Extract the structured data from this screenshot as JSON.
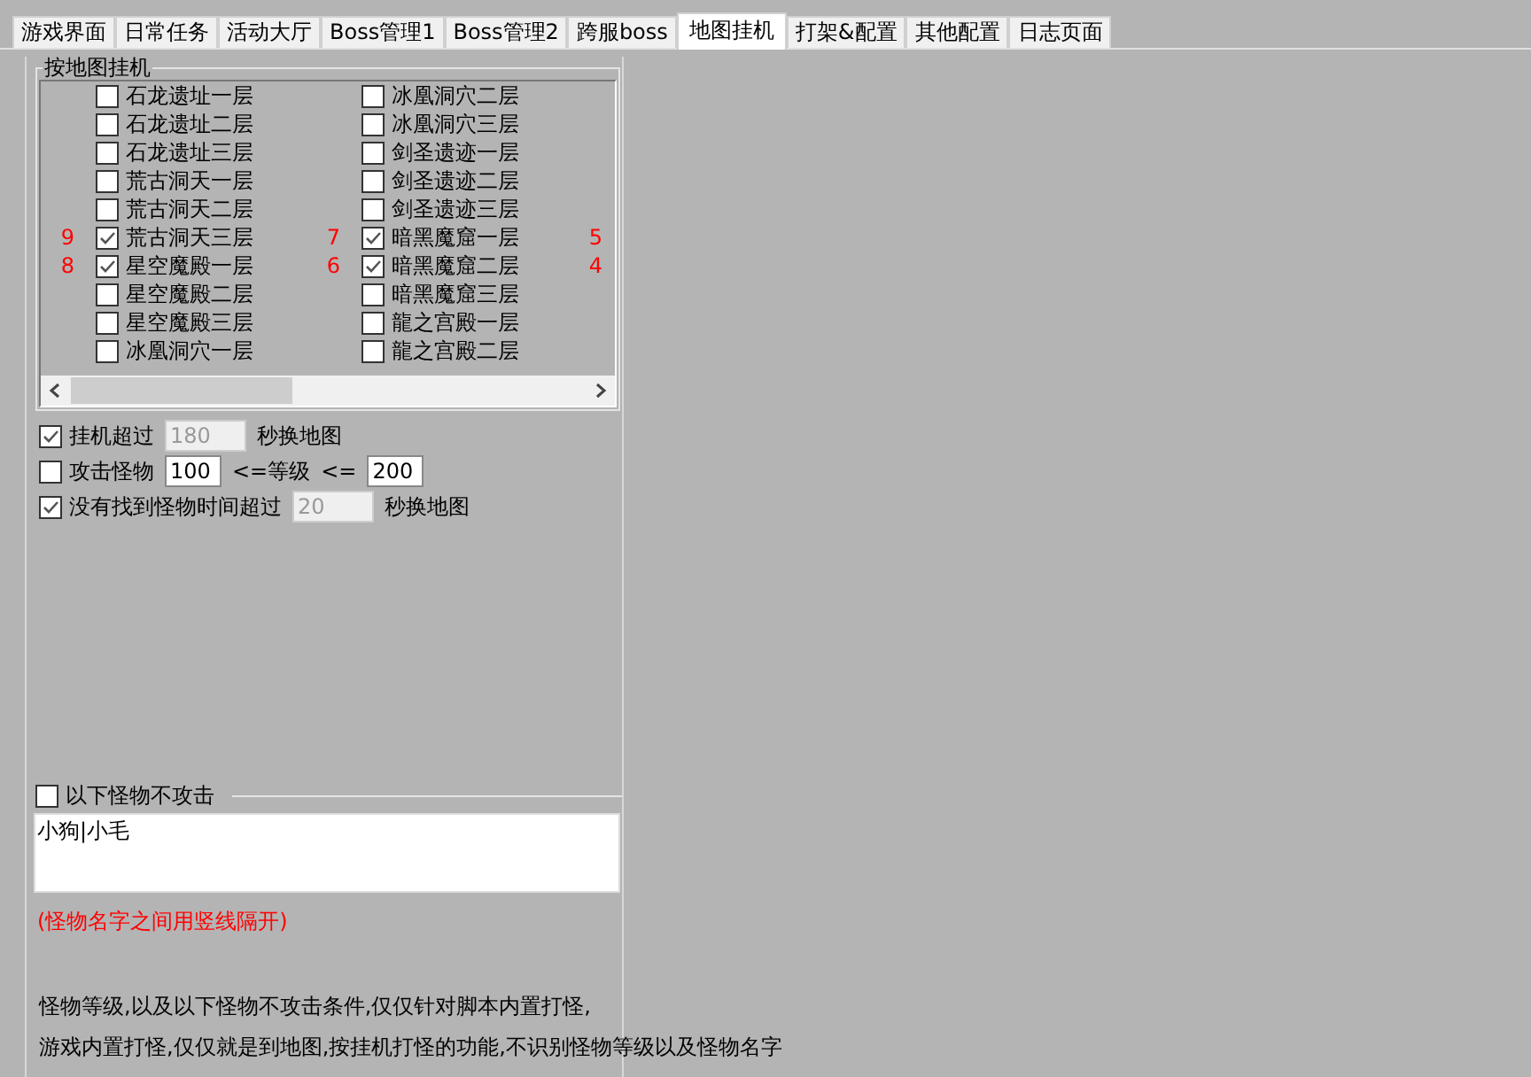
{
  "tabs": [
    {
      "label": "游戏界面",
      "selected": false
    },
    {
      "label": "日常任务",
      "selected": false
    },
    {
      "label": "活动大厅",
      "selected": false
    },
    {
      "label": "Boss管理1",
      "selected": false
    },
    {
      "label": "Boss管理2",
      "selected": false
    },
    {
      "label": "跨服boss",
      "selected": false
    },
    {
      "label": "地图挂机",
      "selected": true
    },
    {
      "label": "打架&配置",
      "selected": false
    },
    {
      "label": "其他配置",
      "selected": false
    },
    {
      "label": "日志页面",
      "selected": false
    }
  ],
  "map_group": {
    "title": "按地图挂机",
    "rows": [
      {
        "cells": [
          {
            "label": "石龙遗址一层",
            "checked": false
          },
          {
            "label": "冰凰洞穴二层",
            "checked": false
          }
        ]
      },
      {
        "cells": [
          {
            "label": "石龙遗址二层",
            "checked": false
          },
          {
            "label": "冰凰洞穴三层",
            "checked": false
          }
        ]
      },
      {
        "cells": [
          {
            "label": "石龙遗址三层",
            "checked": false
          },
          {
            "label": "剑圣遗迹一层",
            "checked": false
          }
        ]
      },
      {
        "cells": [
          {
            "label": "荒古洞天一层",
            "checked": false
          },
          {
            "label": "剑圣遗迹二层",
            "checked": false
          }
        ]
      },
      {
        "cells": [
          {
            "label": "荒古洞天二层",
            "checked": false
          },
          {
            "label": "剑圣遗迹三层",
            "checked": false
          }
        ]
      },
      {
        "cells": [
          {
            "order": "9",
            "label": "荒古洞天三层",
            "checked": true
          },
          {
            "order": "7",
            "label": "暗黑魔窟一层",
            "checked": true
          }
        ],
        "tail": "5"
      },
      {
        "cells": [
          {
            "order": "8",
            "label": "星空魔殿一层",
            "checked": true
          },
          {
            "order": "6",
            "label": "暗黑魔窟二层",
            "checked": true
          }
        ],
        "tail": "4"
      },
      {
        "cells": [
          {
            "label": "星空魔殿二层",
            "checked": false
          },
          {
            "label": "暗黑魔窟三层",
            "checked": false
          }
        ]
      },
      {
        "cells": [
          {
            "label": "星空魔殿三层",
            "checked": false
          },
          {
            "label": "龍之宫殿一层",
            "checked": false
          }
        ]
      },
      {
        "cells": [
          {
            "label": "冰凰洞穴一层",
            "checked": false
          },
          {
            "label": "龍之宫殿二层",
            "checked": false
          }
        ]
      }
    ]
  },
  "options": [
    {
      "checked": true,
      "parts": [
        {
          "kind": "label",
          "text": "挂机超过"
        },
        {
          "kind": "input",
          "value": "180",
          "disabled": true
        },
        {
          "kind": "label",
          "text": "秒换地图"
        }
      ]
    },
    {
      "checked": false,
      "parts": [
        {
          "kind": "label",
          "text": "攻击怪物"
        },
        {
          "kind": "input",
          "value": "100",
          "disabled": false
        },
        {
          "kind": "label",
          "text": "<=等级"
        },
        {
          "kind": "label",
          "text": "<="
        },
        {
          "kind": "input",
          "value": "200",
          "disabled": false
        }
      ]
    },
    {
      "checked": true,
      "parts": [
        {
          "kind": "label",
          "text": "没有找到怪物时间超过"
        },
        {
          "kind": "input",
          "value": "20",
          "disabled": true
        },
        {
          "kind": "label",
          "text": "秒换地图"
        }
      ]
    }
  ],
  "exclude_group": {
    "label": "以下怪物不攻击",
    "checked": false,
    "value": "小狗|小毛"
  },
  "hint": "(怪物名字之间用竖线隔开)",
  "notes": [
    "怪物等级,以及以下怪物不攻击条件,仅仅针对脚本内置打怪,",
    "游戏内置打怪,仅仅就是到地图,按挂机打怪的功能,不识别怪物等级以及怪物名字"
  ]
}
